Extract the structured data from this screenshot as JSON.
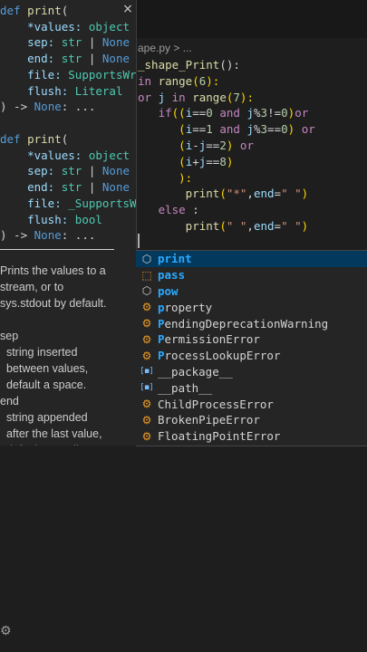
{
  "editor": {
    "breadcrumb": "ape.py > ...",
    "code_lines": [
      {
        "parts": [
          {
            "t": "_shape_Print",
            "c": "fn"
          },
          {
            "t": "():",
            "c": "op"
          }
        ]
      },
      {
        "parts": [
          {
            "t": "in ",
            "c": "kw"
          },
          {
            "t": "range",
            "c": "fn"
          },
          {
            "t": "(",
            "c": "pun"
          },
          {
            "t": "6",
            "c": "num"
          },
          {
            "t": "):",
            "c": "pun"
          }
        ]
      },
      {
        "parts": [
          {
            "t": "or ",
            "c": "kw"
          },
          {
            "t": "j ",
            "c": "var"
          },
          {
            "t": "in ",
            "c": "kw"
          },
          {
            "t": "range",
            "c": "fn"
          },
          {
            "t": "(",
            "c": "pun"
          },
          {
            "t": "7",
            "c": "num"
          },
          {
            "t": "):",
            "c": "pun"
          }
        ]
      },
      {
        "parts": [
          {
            "t": "   if",
            "c": "ctl"
          },
          {
            "t": "((",
            "c": "pun"
          },
          {
            "t": "i",
            "c": "var"
          },
          {
            "t": "==",
            "c": "op"
          },
          {
            "t": "0",
            "c": "num"
          },
          {
            "t": " and ",
            "c": "kw"
          },
          {
            "t": "j",
            "c": "var"
          },
          {
            "t": "%",
            "c": "op"
          },
          {
            "t": "3",
            "c": "num"
          },
          {
            "t": "!=",
            "c": "op"
          },
          {
            "t": "0",
            "c": "num"
          },
          {
            "t": ")",
            "c": "pun"
          },
          {
            "t": "or",
            "c": "kw"
          }
        ]
      },
      {
        "parts": [
          {
            "t": "      (",
            "c": "pun"
          },
          {
            "t": "i",
            "c": "var"
          },
          {
            "t": "==",
            "c": "op"
          },
          {
            "t": "1",
            "c": "num"
          },
          {
            "t": " and ",
            "c": "kw"
          },
          {
            "t": "j",
            "c": "var"
          },
          {
            "t": "%",
            "c": "op"
          },
          {
            "t": "3",
            "c": "num"
          },
          {
            "t": "==",
            "c": "op"
          },
          {
            "t": "0",
            "c": "num"
          },
          {
            "t": ")",
            "c": "pun"
          },
          {
            "t": " or",
            "c": "kw"
          }
        ]
      },
      {
        "parts": [
          {
            "t": "      (",
            "c": "pun"
          },
          {
            "t": "i",
            "c": "var"
          },
          {
            "t": "-",
            "c": "op"
          },
          {
            "t": "j",
            "c": "var"
          },
          {
            "t": "==",
            "c": "op"
          },
          {
            "t": "2",
            "c": "num"
          },
          {
            "t": ")",
            "c": "pun"
          },
          {
            "t": " or",
            "c": "kw"
          }
        ]
      },
      {
        "parts": [
          {
            "t": "      (",
            "c": "pun"
          },
          {
            "t": "i",
            "c": "var"
          },
          {
            "t": "+",
            "c": "op"
          },
          {
            "t": "j",
            "c": "var"
          },
          {
            "t": "==",
            "c": "op"
          },
          {
            "t": "8",
            "c": "num"
          },
          {
            "t": ")",
            "c": "pun"
          }
        ]
      },
      {
        "parts": [
          {
            "t": "      ):",
            "c": "pun"
          }
        ]
      },
      {
        "parts": [
          {
            "t": "       print",
            "c": "fn"
          },
          {
            "t": "(",
            "c": "pun"
          },
          {
            "t": "\"*\"",
            "c": "str"
          },
          {
            "t": ",",
            "c": "op"
          },
          {
            "t": "end",
            "c": "var"
          },
          {
            "t": "=",
            "c": "op"
          },
          {
            "t": "\" \"",
            "c": "str"
          },
          {
            "t": ")",
            "c": "pun"
          }
        ]
      },
      {
        "parts": [
          {
            "t": "   else ",
            "c": "ctl"
          },
          {
            "t": ":",
            "c": "op"
          }
        ]
      },
      {
        "parts": [
          {
            "t": "       print",
            "c": "fn"
          },
          {
            "t": "(",
            "c": "pun"
          },
          {
            "t": "\" \"",
            "c": "str"
          },
          {
            "t": ",",
            "c": "op"
          },
          {
            "t": "end",
            "c": "var"
          },
          {
            "t": "=",
            "c": "op"
          },
          {
            "t": "\" \"",
            "c": "str"
          },
          {
            "t": ")",
            "c": "pun"
          }
        ]
      }
    ]
  },
  "hover": {
    "close_label": "×",
    "signature1": [
      {
        "parts": [
          {
            "t": "def ",
            "c": "k"
          },
          {
            "t": "print",
            "c": "f"
          },
          {
            "t": "(",
            "c": "o"
          }
        ]
      },
      {
        "parts": [
          {
            "t": "    *values: ",
            "c": "p"
          },
          {
            "t": "object",
            "c": "t"
          }
        ]
      },
      {
        "parts": [
          {
            "t": "    sep: ",
            "c": "p"
          },
          {
            "t": "str",
            "c": "t"
          },
          {
            "t": " | ",
            "c": "o"
          },
          {
            "t": "None",
            "c": "c"
          }
        ]
      },
      {
        "parts": [
          {
            "t": "    end: ",
            "c": "p"
          },
          {
            "t": "str",
            "c": "t"
          },
          {
            "t": " | ",
            "c": "o"
          },
          {
            "t": "None",
            "c": "c"
          }
        ]
      },
      {
        "parts": [
          {
            "t": "    file: ",
            "c": "p"
          },
          {
            "t": "SupportsWrite",
            "c": "t"
          }
        ]
      },
      {
        "parts": [
          {
            "t": "    flush: ",
            "c": "p"
          },
          {
            "t": "Literal",
            "c": "t"
          }
        ]
      },
      {
        "parts": [
          {
            "t": ") -> ",
            "c": "o"
          },
          {
            "t": "None",
            "c": "c"
          },
          {
            "t": ": ...",
            "c": "o"
          }
        ]
      }
    ],
    "signature2": [
      {
        "parts": [
          {
            "t": "def ",
            "c": "k"
          },
          {
            "t": "print",
            "c": "f"
          },
          {
            "t": "(",
            "c": "o"
          }
        ]
      },
      {
        "parts": [
          {
            "t": "    *values: ",
            "c": "p"
          },
          {
            "t": "object",
            "c": "t"
          }
        ]
      },
      {
        "parts": [
          {
            "t": "    sep: ",
            "c": "p"
          },
          {
            "t": "str",
            "c": "t"
          },
          {
            "t": " | ",
            "c": "o"
          },
          {
            "t": "None",
            "c": "c"
          }
        ]
      },
      {
        "parts": [
          {
            "t": "    end: ",
            "c": "p"
          },
          {
            "t": "str",
            "c": "t"
          },
          {
            "t": " | ",
            "c": "o"
          },
          {
            "t": "None",
            "c": "c"
          }
        ]
      },
      {
        "parts": [
          {
            "t": "    file: ",
            "c": "p"
          },
          {
            "t": "_SupportsWrite",
            "c": "t"
          }
        ]
      },
      {
        "parts": [
          {
            "t": "    flush: ",
            "c": "p"
          },
          {
            "t": "bool",
            "c": "t"
          }
        ]
      },
      {
        "parts": [
          {
            "t": ") -> ",
            "c": "o"
          },
          {
            "t": "None",
            "c": "c"
          },
          {
            "t": ": ...",
            "c": "o"
          }
        ]
      }
    ],
    "doc_text": "Prints the values to a\nstream, or to\nsys.stdout by default.\n\nsep\n  string inserted\n  between values,\n  default a space.\nend\n  string appended\n  after the last value,\n  default a newline."
  },
  "suggest": {
    "items": [
      {
        "icon": "cube-icon",
        "match": "print",
        "rest": ""
      },
      {
        "icon": "keyword-icon",
        "match": "pass",
        "rest": ""
      },
      {
        "icon": "cube-icon",
        "match": "pow",
        "rest": ""
      },
      {
        "icon": "class-icon",
        "match": "p",
        "rest": "roperty"
      },
      {
        "icon": "class-icon",
        "match": "P",
        "rest": "endingDeprecationWarning"
      },
      {
        "icon": "class-icon",
        "match": "P",
        "rest": "ermissionError"
      },
      {
        "icon": "class-icon",
        "match": "P",
        "rest": "rocessLookupError"
      },
      {
        "icon": "variable-icon",
        "match": "",
        "rest": "__package__"
      },
      {
        "icon": "variable-icon",
        "match": "",
        "rest": "__path__"
      },
      {
        "icon": "class-icon",
        "match": "",
        "rest": "ChildProcessError"
      },
      {
        "icon": "class-icon",
        "match": "",
        "rest": "BrokenPipeError"
      },
      {
        "icon": "class-icon",
        "match": "",
        "rest": "FloatingPointError"
      }
    ]
  },
  "colors": {
    "accent": "#04395e",
    "match_highlight": "#2aaaff",
    "class_icon": "#ee9d28"
  }
}
